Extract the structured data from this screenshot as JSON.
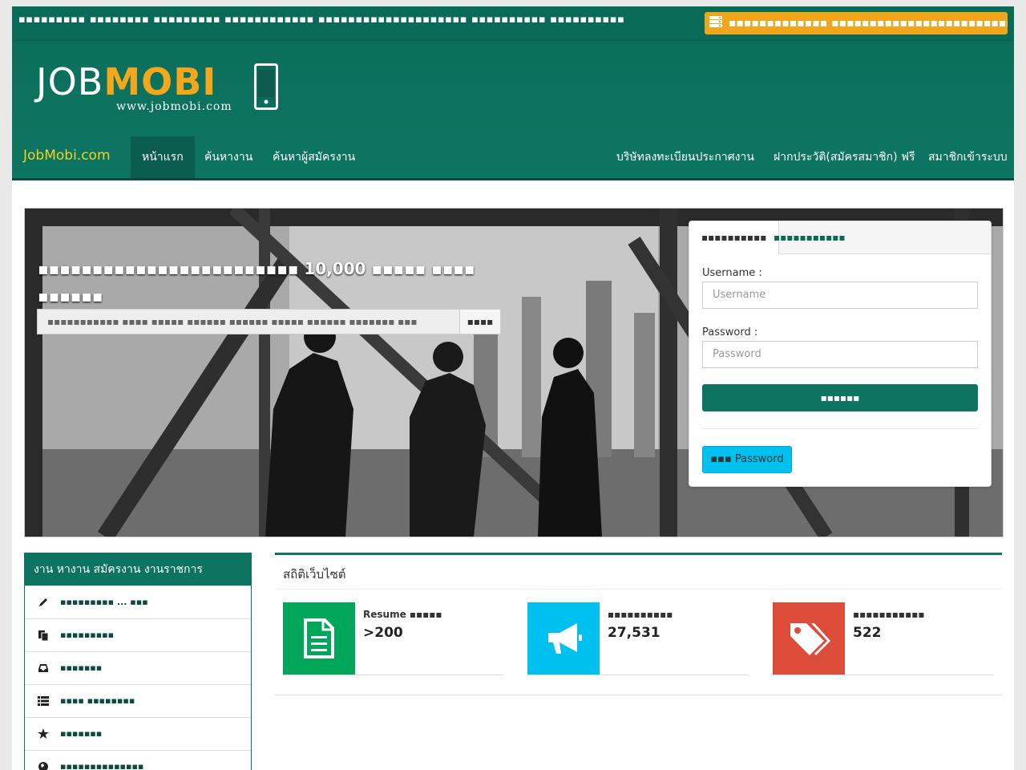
{
  "topbar": {
    "text": "▪▪▪▪▪▪▪▪▪ ▪▪▪▪▪▪▪▪ ▪▪▪▪▪▪▪▪▪ ▪▪▪▪▪▪▪▪▪▪▪▪ ▪▪▪▪▪▪▪▪▪▪▪▪▪▪▪▪▪▪▪▪ ▪▪▪▪▪▪▪▪▪▪ ▪▪▪▪▪▪▪▪▪▪",
    "button_label": "▪▪▪▪▪▪▪▪▪▪▪▪▪ ▪▪▪▪▪▪▪▪▪▪▪▪▪▪▪▪▪▪▪▪▪▪▪▪▪▪",
    "button_color": "#f0a51a"
  },
  "logo": {
    "part1": "JOB",
    "part2": "MOBI",
    "url": "www.jobmobi.com"
  },
  "nav": {
    "brand": "JobMobi.com",
    "items": [
      "หน้าแรก",
      "ค้นหางาน",
      "ค้นหาผู้สมัครงาน"
    ],
    "right_items": [
      "บริษัทลงทะเบียนประกาศงาน",
      "ฝากประวัติ(สมัครสมาชิก) ฟรี",
      "สมาชิกเข้าระบบ"
    ],
    "accent": "#0c7460"
  },
  "hero": {
    "title": "▪▪▪▪▪▪▪▪▪▪▪▪▪▪▪▪▪▪▪▪▪▪▪▪ 10,000 ▪▪▪▪▪ ▪▪▪▪ ▪▪▪▪▪▪",
    "search_placeholder": "▪▪▪▪▪▪▪▪▪▪▪ ▪▪▪▪ ▪▪▪▪▪ ▪▪▪▪▪▪ ▪▪▪▪▪▪ ▪▪▪▪▪ ▪▪▪▪▪▪ ▪▪▪▪▪▪▪ ▪▪▪",
    "search_button": "▪▪▪▪"
  },
  "login": {
    "tab_active": "▪▪▪▪▪▪▪▪▪▪",
    "tab_other": "▪▪▪▪▪▪▪▪▪▪▪",
    "username_label": "Username :",
    "username_placeholder": "Username",
    "password_label": "Password :",
    "password_placeholder": "Password",
    "submit": "▪▪▪▪▪▪",
    "forgot": "▪▪▪ Password"
  },
  "sidebar": {
    "title": "งาน หางาน สมัครงาน งานราชการ",
    "items": [
      {
        "icon": "pencil-icon",
        "label": "▪▪▪▪▪▪▪▪▪ ... ▪▪▪"
      },
      {
        "icon": "files-icon",
        "label": "▪▪▪▪▪▪▪▪▪"
      },
      {
        "icon": "inbox-icon",
        "label": "▪▪▪▪▪▪▪"
      },
      {
        "icon": "list-icon",
        "label": "▪▪▪▪ ▪▪▪▪▪▪▪▪"
      },
      {
        "icon": "star-icon",
        "label": "▪▪▪▪▪▪▪"
      },
      {
        "icon": "globe-icon",
        "label": "▪▪▪▪▪▪▪▪▪▪▪▪▪▪"
      }
    ]
  },
  "stats": {
    "title": "สถิติเว็บไซต์",
    "boxes": [
      {
        "icon": "document-icon",
        "color": "#00a65a",
        "label": "Resume ▪▪▪▪▪",
        "value": ">200"
      },
      {
        "icon": "megaphone-icon",
        "color": "#00c0ef",
        "label": "▪▪▪▪▪▪▪▪▪▪",
        "value": "27,531"
      },
      {
        "icon": "tags-icon",
        "color": "#dd4b39",
        "label": "▪▪▪▪▪▪▪▪▪▪▪",
        "value": "522"
      }
    ]
  }
}
